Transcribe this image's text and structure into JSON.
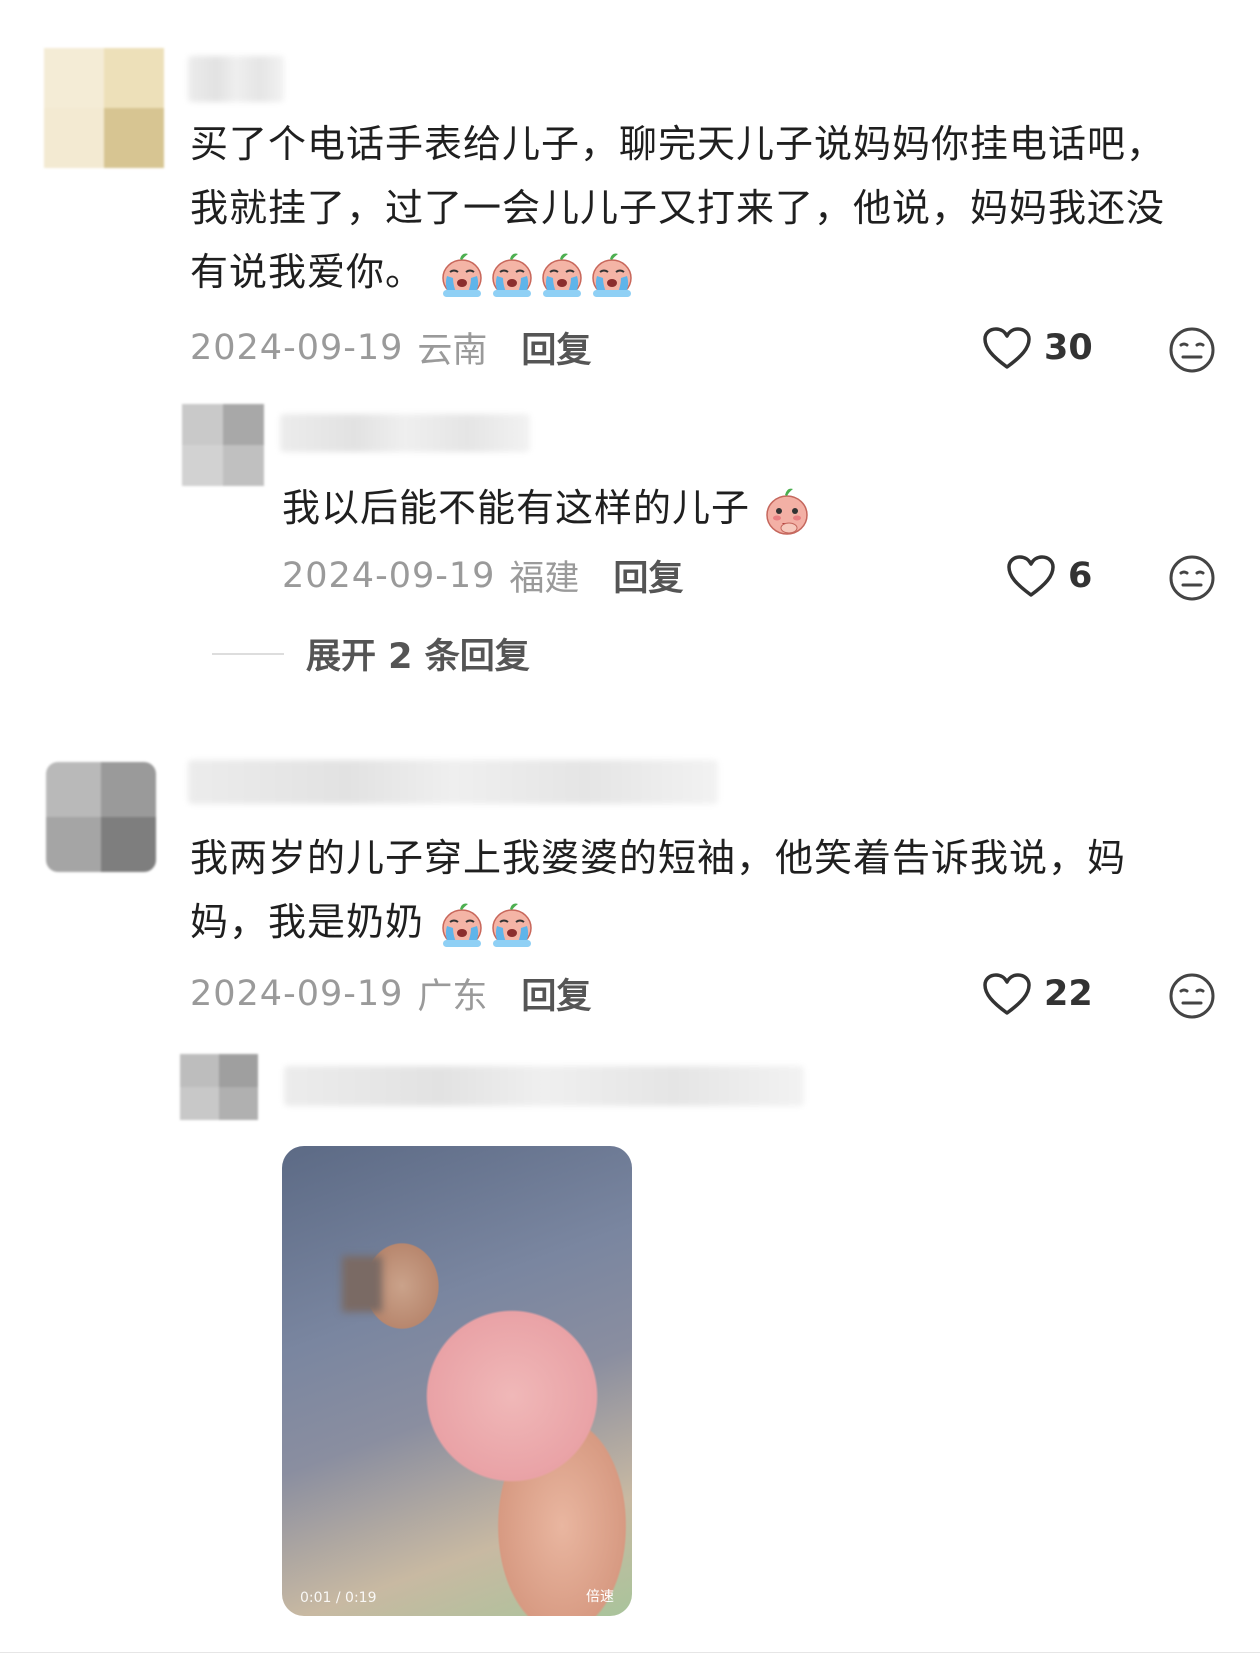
{
  "comments": [
    {
      "text_line1": "买了个电话手表给儿子，聊完天儿子说妈妈你挂电话吧，",
      "text_line2": "我就挂了，过了一会儿儿子又打来了，他说，妈妈我还没",
      "text_line3": "有说我爱你。",
      "date": "2024-09-19",
      "location": "云南",
      "reply_label": "回复",
      "likes": "30"
    },
    {
      "text": "我以后能不能有这样的儿子",
      "date": "2024-09-19",
      "location": "福建",
      "reply_label": "回复",
      "likes": "6",
      "expand_label": "展开 2 条回复"
    },
    {
      "text_line1": "我两岁的儿子穿上我婆婆的短袖，他笑着告诉我说，妈",
      "text_line2": "妈，我是奶奶",
      "date": "2024-09-19",
      "location": "广东",
      "reply_label": "回复",
      "likes": "22"
    },
    {
      "video": {
        "timestamp": "0:01 / 0:19",
        "speed_label": "倍速"
      }
    }
  ],
  "icons": {
    "like": "heart-outline-icon",
    "reaction": "neutral-face-icon",
    "emoji_cry": "crying-emoji",
    "emoji_shy": "blushing-emoji"
  }
}
